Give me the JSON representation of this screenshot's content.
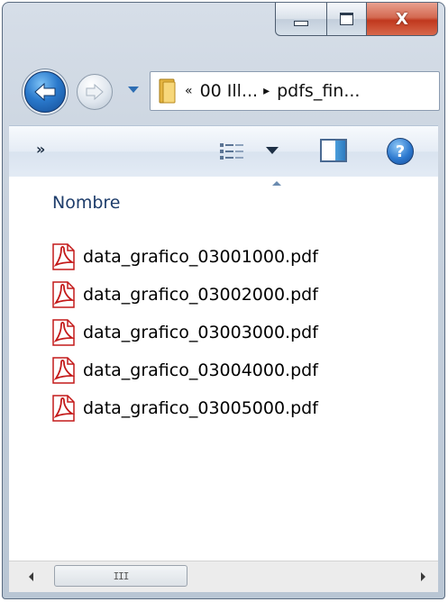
{
  "window": {
    "caption_buttons": {
      "minimize_icon": "minimize-icon",
      "maximize_icon": "maximize-icon",
      "close_label": "X"
    }
  },
  "navigation": {
    "back_icon": "arrow-left-icon",
    "forward_icon": "arrow-right-icon",
    "history_icon": "chevron-down-icon"
  },
  "address": {
    "folder_icon": "folder-icon",
    "overflow_glyph": "«",
    "crumbs": [
      "00 Ill...",
      "pdfs_fin..."
    ],
    "separator_glyph": "▸"
  },
  "command_bar": {
    "more_label": "»",
    "views_icon": "details-view-icon",
    "preview_icon": "preview-pane-icon",
    "help_label": "?"
  },
  "file_list": {
    "column_header": "Nombre",
    "files": [
      {
        "name": "data_grafico_03001000.pdf",
        "icon": "pdf-icon"
      },
      {
        "name": "data_grafico_03002000.pdf",
        "icon": "pdf-icon"
      },
      {
        "name": "data_grafico_03003000.pdf",
        "icon": "pdf-icon"
      },
      {
        "name": "data_grafico_03004000.pdf",
        "icon": "pdf-icon"
      },
      {
        "name": "data_grafico_03005000.pdf",
        "icon": "pdf-icon"
      }
    ]
  },
  "scrollbar": {
    "grip_label": "III"
  },
  "colors": {
    "header_text": "#1e3d6b",
    "close_button": "#c0381e",
    "pdf_red": "#c41a1a"
  }
}
